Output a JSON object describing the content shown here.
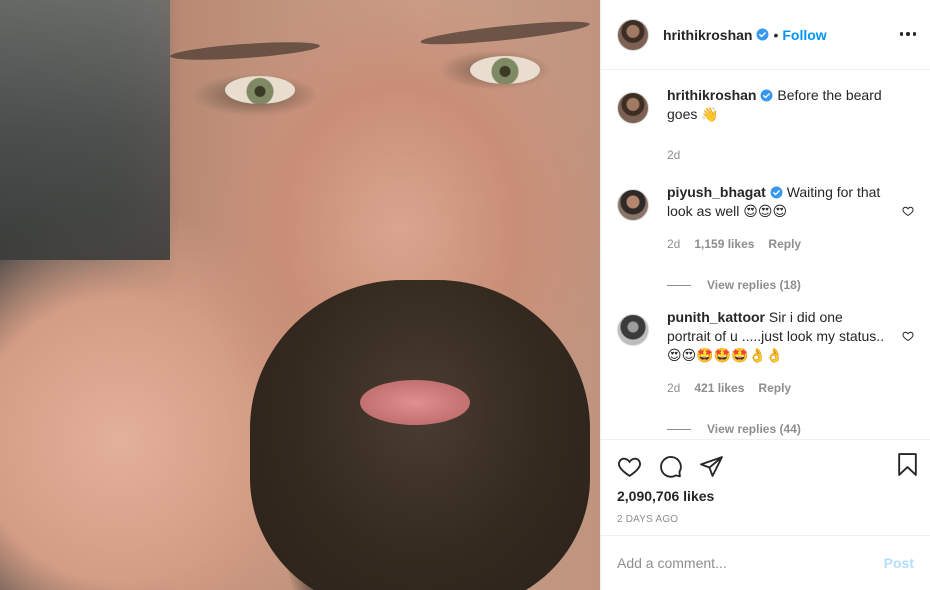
{
  "header": {
    "username": "hrithikroshan",
    "separator": "•",
    "follow_label": "Follow",
    "more_icon": "more-options-icon"
  },
  "caption": {
    "username": "hrithikroshan",
    "text": "Before the beard goes 👋",
    "time": "2d"
  },
  "comments": [
    {
      "username": "piyush_bhagat",
      "verified": true,
      "text": "Waiting for that look as well 😍😍😍",
      "time": "2d",
      "likes": "1,159 likes",
      "reply_label": "Reply",
      "view_replies": "View replies (18)"
    },
    {
      "username": "punith_kattoor",
      "verified": false,
      "text": "Sir i did one portrait of u .....just look my status..😍😍🤩🤩🤩👌👌",
      "time": "2d",
      "likes": "421 likes",
      "reply_label": "Reply",
      "view_replies": "View replies (44)"
    }
  ],
  "actions": {
    "likes": "2,090,706 likes",
    "timestamp": "2 DAYS AGO"
  },
  "add_comment": {
    "placeholder": "Add a comment...",
    "post_label": "Post"
  },
  "colors": {
    "accent": "#0095f6",
    "post_disabled": "#b2dffc",
    "muted": "#8e8e8e"
  }
}
